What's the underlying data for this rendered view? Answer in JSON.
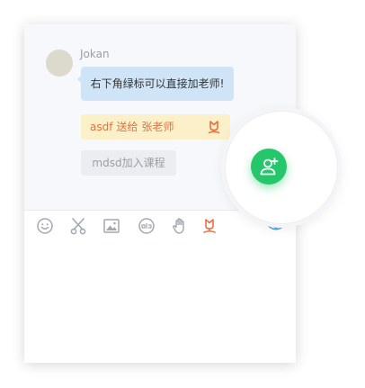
{
  "chat": {
    "username": "Jokan",
    "message": "右下角绿标可以直接加老师!",
    "gift_notice": {
      "sender": "asdf",
      "action": "送给",
      "recipient": "张老师"
    },
    "join_notice": "mdsd加入课程"
  },
  "toolbar": {
    "icons": [
      "emoji-icon",
      "scissors-icon",
      "image-icon",
      "gift-icon",
      "raise-hand-icon",
      "flower-icon",
      "eye-icon"
    ]
  },
  "colors": {
    "accent_green": "#25c76a",
    "bubble_blue": "#cfe4f7",
    "gift_bg": "#fbf0c8",
    "gift_text": "#e96f3f",
    "icon_gray": "#a3a8b0",
    "eye_blue": "#4aa3e8"
  }
}
